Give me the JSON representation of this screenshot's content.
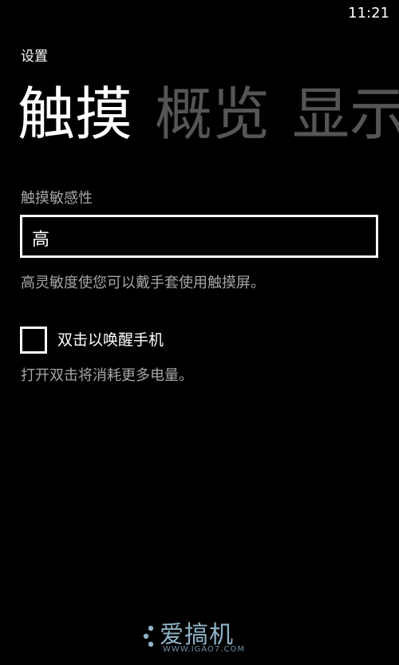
{
  "status_bar": {
    "time": "11:21"
  },
  "app_title": "设置",
  "pivot": {
    "active": "触摸",
    "items": [
      "概览",
      "显示"
    ]
  },
  "touch_sensitivity": {
    "label": "触摸敏感性",
    "value": "高",
    "hint": "高灵敏度使您可以戴手套使用触摸屏。"
  },
  "double_tap": {
    "label": "双击以唤醒手机",
    "checked": false,
    "hint": "打开双击将消耗更多电量。"
  },
  "watermark": {
    "main": "爱搞机",
    "sub": "WWW.IGAO7.COM"
  },
  "colors": {
    "background": "#000000",
    "foreground": "#ffffff",
    "subtle_text": "#a6a6a6",
    "inactive_pivot": "#555555"
  }
}
